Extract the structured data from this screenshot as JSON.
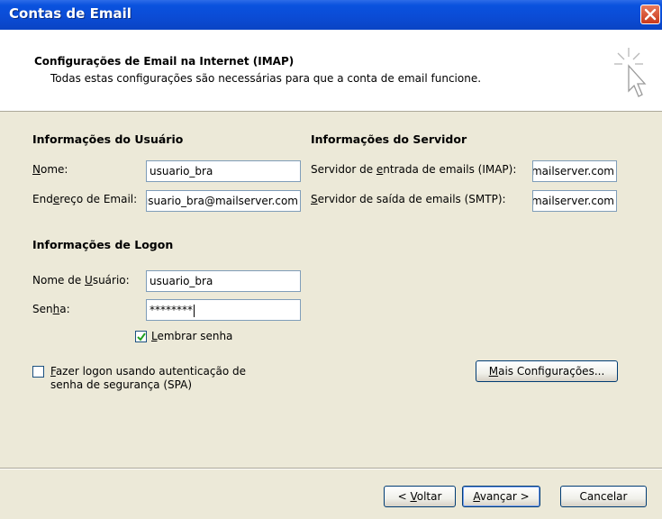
{
  "window": {
    "title": "Contas de Email"
  },
  "header": {
    "title": "Configurações de Email na Internet (IMAP)",
    "subtitle": "Todas estas configurações são necessárias para que a conta de email funcione."
  },
  "user_info": {
    "section_title": "Informações do Usuário",
    "name_label": "Nome:",
    "name_value": "usuario_bra",
    "email_label": "Endereço de Email:",
    "email_value": "usuario_bra@mailserver.com"
  },
  "server_info": {
    "section_title": "Informações do Servidor",
    "incoming_label": "Servidor de entrada de emails (IMAP):",
    "incoming_value": "mailserver.com",
    "outgoing_label": "Servidor de saída de emails (SMTP):",
    "outgoing_value": "mailserver.com"
  },
  "logon_info": {
    "section_title": "Informações de Logon",
    "username_label": "Nome de Usuário:",
    "username_value": "usuario_bra",
    "password_label": "Senha:",
    "password_value": "********",
    "remember_label": "Lembrar senha",
    "remember_checked": true
  },
  "spa": {
    "label_line1": "Fazer logon usando autenticação de",
    "label_line2": "senha de segurança (SPA)",
    "checked": false
  },
  "buttons": {
    "more_settings": "Mais Configurações...",
    "back": "< Voltar",
    "next": "Avançar >",
    "cancel": "Cancelar"
  },
  "colors": {
    "titlebar": "#0A52DE",
    "dialog_bg": "#ECE9D8",
    "field_border": "#7F9DB9",
    "button_border": "#003C74"
  }
}
